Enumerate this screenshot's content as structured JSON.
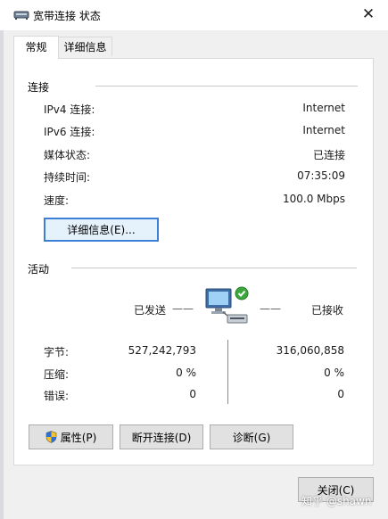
{
  "window": {
    "title": "宽带连接 状态",
    "close_symbol": "✕",
    "icon": "network-dialup-icon"
  },
  "tabs": [
    {
      "label": "常规",
      "active": true
    },
    {
      "label": "详细信息",
      "active": false
    }
  ],
  "connection": {
    "header": "连接",
    "rows": [
      {
        "label": "IPv4 连接:",
        "value": "Internet"
      },
      {
        "label": "IPv6 连接:",
        "value": "Internet"
      },
      {
        "label": "媒体状态:",
        "value": "已连接"
      },
      {
        "label": "持续时间:",
        "value": "07:35:09"
      },
      {
        "label": "速度:",
        "value": "100.0 Mbps"
      }
    ],
    "details_button": "详细信息(E)..."
  },
  "activity": {
    "header": "活动",
    "sent_label": "已发送",
    "received_label": "已接收",
    "dash_left": "——",
    "dash_right": "——",
    "icon": "network-computer-connected-icon",
    "rows": [
      {
        "label": "字节:",
        "sent": "527,242,793",
        "received": "316,060,858"
      },
      {
        "label": "压缩:",
        "sent": "0 %",
        "received": "0 %"
      },
      {
        "label": "错误:",
        "sent": "0",
        "received": "0"
      }
    ]
  },
  "buttons": {
    "properties": "属性(P)",
    "properties_icon": "shield-icon",
    "disconnect": "断开连接(D)",
    "diagnose": "诊断(G)",
    "close": "关闭(C)"
  },
  "watermark": "知乎 @shawn",
  "colors": {
    "accent": "#3c7fd6",
    "window_bg": "#f0f0f0",
    "panel_bg": "#ffffff"
  }
}
